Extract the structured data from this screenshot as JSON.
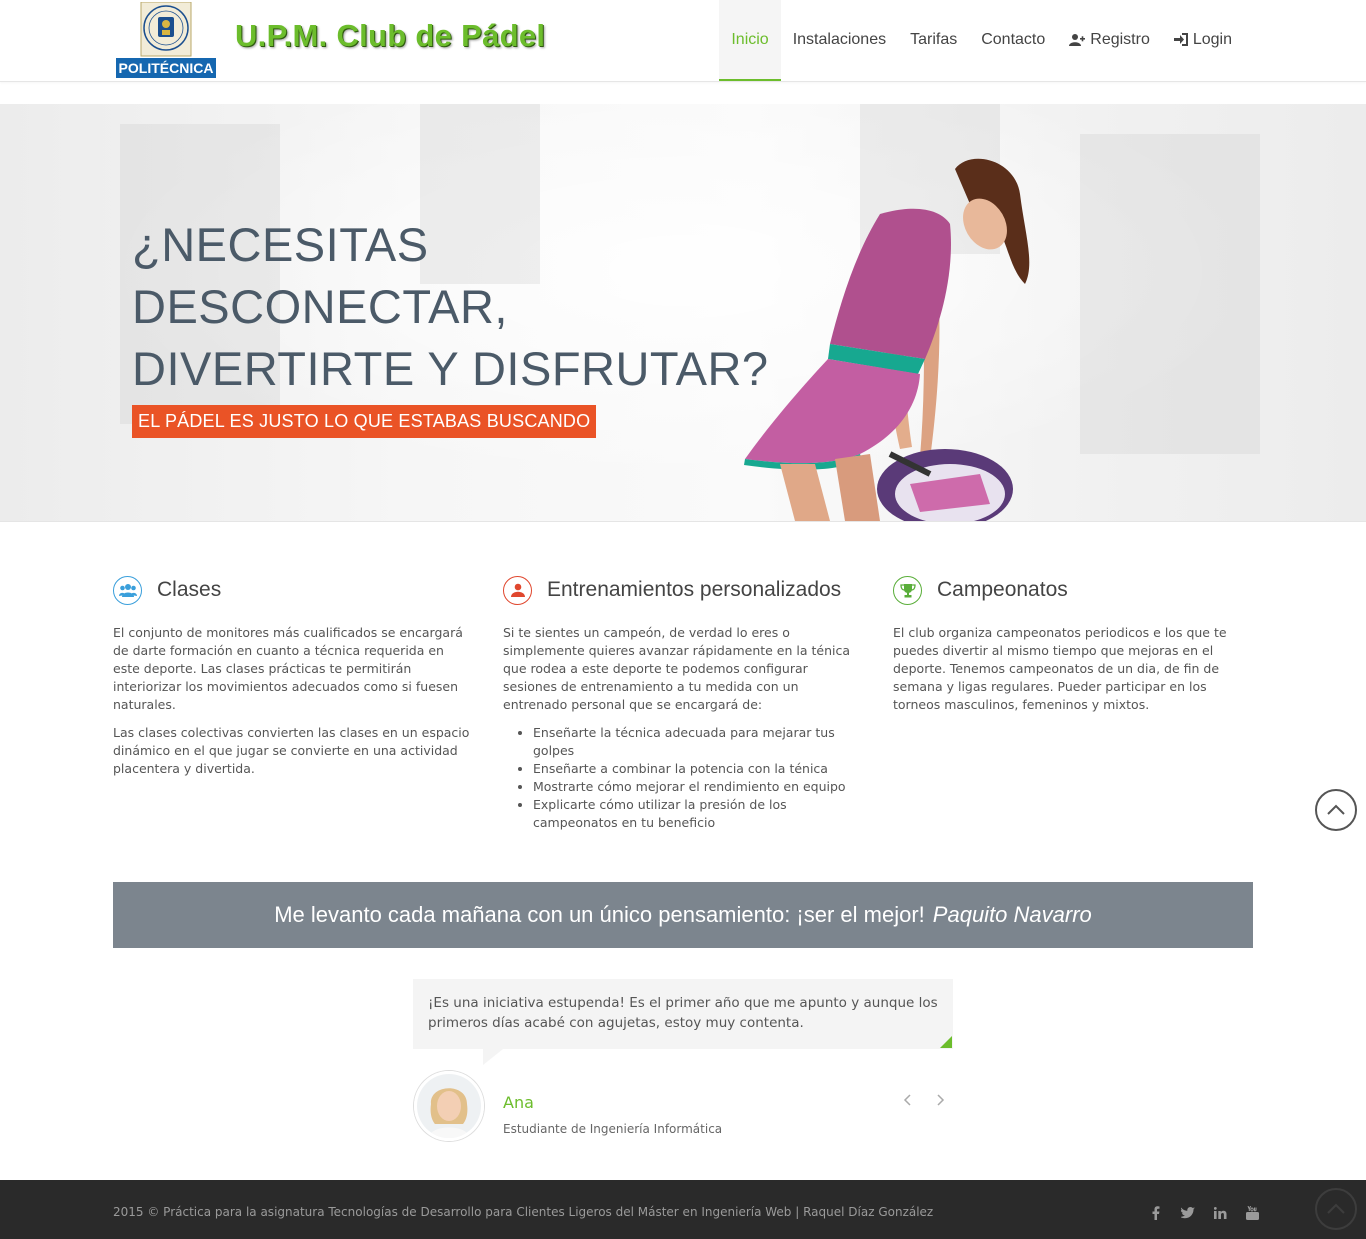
{
  "header": {
    "logo_caption": "POLITÉCNICA",
    "site_title": "U.P.M. Club de Pádel",
    "nav": [
      {
        "label": "Inicio",
        "active": true
      },
      {
        "label": "Instalaciones"
      },
      {
        "label": "Tarifas"
      },
      {
        "label": "Contacto"
      },
      {
        "label": "Registro",
        "icon": "user-plus-icon"
      },
      {
        "label": "Login",
        "icon": "sign-in-icon"
      }
    ]
  },
  "hero": {
    "title_line1": "¿NECESITAS DESCONECTAR,",
    "title_line2": "DIVERTIRTE Y DISFRUTAR?",
    "badge": "EL PÁDEL ES JUSTO LO QUE ESTABAS BUSCANDO"
  },
  "features": [
    {
      "title": "Clases",
      "icon": "users-icon",
      "color": "#3a9fdb",
      "paragraphs": [
        "El conjunto de monitores más cualificados se encargará de darte formación en cuanto a técnica requerida en este deporte. Las clases prácticas te permitirán interiorizar los movimientos adecuados como si fuesen naturales.",
        "Las clases colectivas convierten las clases en un espacio dinámico en el que jugar se convierte en una actividad placentera y divertida."
      ]
    },
    {
      "title": "Entrenamientos personalizados",
      "icon": "user-icon",
      "color": "#e0472e",
      "intro": "Si te sientes un campeón, de verdad lo eres o simplemente quieres avanzar rápidamente en la ténica que rodea a este deporte te podemos configurar sesiones de entrenamiento a tu medida con un entrenado personal que se encargará de:",
      "list": [
        "Enseñarte la técnica adecuada para mejarar tus golpes",
        "Enseñarte a combinar la potencia con la ténica",
        "Mostrarte cómo mejorar el rendimiento en equipo",
        "Explicarte cómo utilizar la presión de los campeonatos en tu beneficio"
      ]
    },
    {
      "title": "Campeonatos",
      "icon": "trophy-icon",
      "color": "#5aae3a",
      "paragraphs": [
        "El club organiza campeonatos periodicos e los que te puedes divertir al mismo tiempo que mejoras en el deporte. Tenemos campeonatos de un dia, de fin de semana y ligas regulares. Pueder participar en los torneos masculinos, femeninos y mixtos."
      ]
    }
  ],
  "quote": {
    "text": "Me levanto cada mañana con un único pensamiento: ¡ser el mejor!",
    "author": "Paquito Navarro"
  },
  "testimonial": {
    "text": "¡Es una iniciativa estupenda! Es el primer año que me apunto y aunque los primeros días acabé con agujetas, estoy muy contenta.",
    "name": "Ana",
    "role": "Estudiante de Ingeniería Informática"
  },
  "footer": {
    "text": "2015 © Práctica para la asignatura Tecnologías de Desarrollo para Clientes Ligeros del Máster en Ingeniería Web | Raquel Díaz González",
    "social": [
      "facebook-icon",
      "twitter-icon",
      "linkedin-icon",
      "youtube-icon"
    ]
  },
  "colors": {
    "brand_green": "#6cbd2c",
    "badge_orange": "#ea5326",
    "quote_bg": "#7c858e",
    "footer_bg": "#2a2a2a"
  }
}
